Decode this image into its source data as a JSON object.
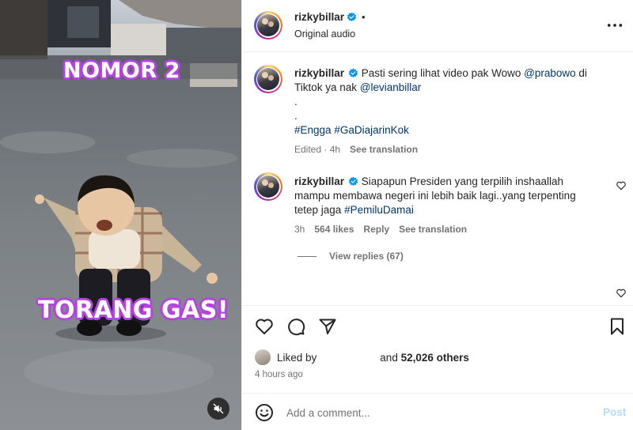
{
  "media": {
    "caption_top": "NOMOR 2",
    "caption_bottom": "TORANG GAS!"
  },
  "header": {
    "username": "rizkybillar",
    "dot": "•",
    "audio": "Original audio"
  },
  "post": {
    "username": "rizkybillar",
    "text_1": "Pasti sering lihat video pak Wowo ",
    "mention_1": "@prabowo",
    "text_2": " di Tiktok ya nak ",
    "mention_2": "@levianbillar",
    "dot_1": ".",
    "dot_2": ".",
    "hashtag_1": "#Engga",
    "hashtag_2": "#GaDiajarinKok",
    "edited": "Edited · 4h",
    "see_translation": "See translation"
  },
  "comment": {
    "username": "rizkybillar",
    "text": "Siapapun Presiden yang terpilih inshaallah mampu membawa negeri ini lebih baik lagi..yang terpenting tetep jaga ",
    "hashtag": "#PemiluDamai",
    "time": "3h",
    "likes": "564 likes",
    "reply": "Reply",
    "see_translation": "See translation",
    "view_replies": "View replies (67)"
  },
  "likes": {
    "liked_by": "Liked by",
    "and": "and",
    "others": "52,026 others"
  },
  "timestamp": "4 hours ago",
  "add_comment": {
    "placeholder": "Add a comment...",
    "post_label": "Post"
  },
  "colors": {
    "link": "#00376b",
    "verified": "#0095f6",
    "caption_stroke": "#b544e0",
    "post_disabled": "#b3dbff"
  }
}
